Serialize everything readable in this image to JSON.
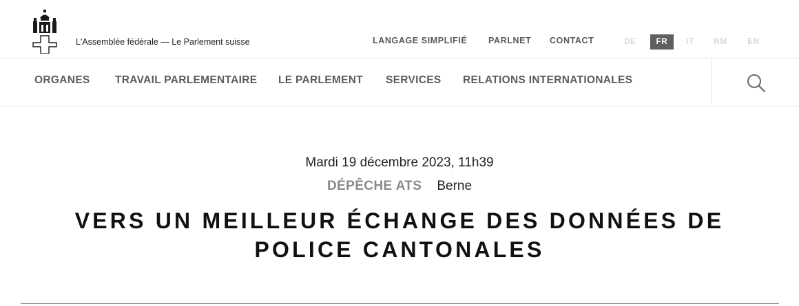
{
  "header": {
    "site_name": "L'Assemblée fédérale — Le Parlement suisse",
    "utility_links": [
      "LANGAGE SIMPLIFIÉ",
      "PARLNET",
      "CONTACT"
    ],
    "languages": [
      {
        "code": "DE",
        "active": false
      },
      {
        "code": "FR",
        "active": true
      },
      {
        "code": "IT",
        "active": false
      },
      {
        "code": "RM",
        "active": false
      },
      {
        "code": "EN",
        "active": false
      }
    ]
  },
  "main_nav": {
    "items": [
      "ORGANES",
      "TRAVAIL PARLEMENTAIRE",
      "LE PARLEMENT",
      "SERVICES",
      "RELATIONS INTERNATIONALES"
    ],
    "search_icon": "search-icon"
  },
  "article": {
    "date": "Mardi 19 décembre 2023, 11h39",
    "type": "DÉPÊCHE ATS",
    "location": "Berne",
    "title": "VERS UN MEILLEUR ÉCHANGE DES DONNÉES DE POLICE CANTONALES"
  },
  "colors": {
    "active_language_bg": "#5f5f5f",
    "nav_text": "#5c5c5c",
    "inactive_language": "#d7d7d7"
  }
}
